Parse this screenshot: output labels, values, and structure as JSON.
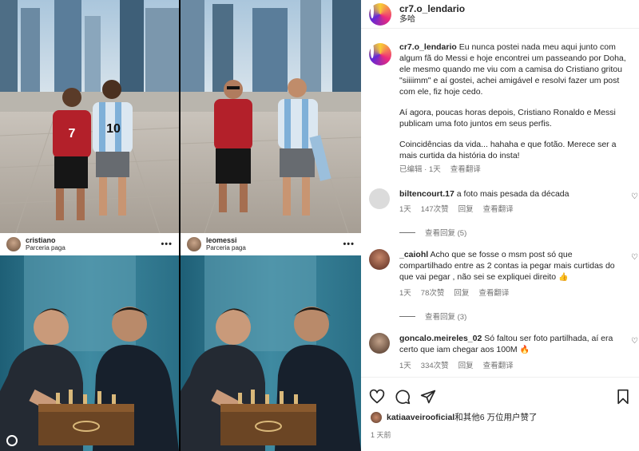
{
  "colors": {
    "accent": "#0095f6",
    "text": "#262626",
    "muted": "#737373",
    "divider": "#efefef"
  },
  "image_cards": {
    "left": {
      "username": "cristiano",
      "label": "Parceria paga"
    },
    "right": {
      "username": "leomessi",
      "label": "Parceria paga"
    },
    "more_icon": "more-dots-icon"
  },
  "post": {
    "username": "cr7.o_lendario",
    "location": "多哈"
  },
  "caption": {
    "username": "cr7.o_lendario",
    "p1": "Eu nunca postei nada meu aqui junto com algum fã do Messi e hoje encontrei um passeando por Doha, ele mesmo quando me viu com a camisa do Cristiano gritou \"siiiimm\" e aí gostei, achei amigável e resolvi fazer um post com ele, fiz hoje cedo.",
    "p2": "Aí agora, poucas horas depois, Cristiano Ronaldo e Messi publicam uma foto juntos em seus perfis.",
    "p3": "Coincidências da vida... hahaha e que fotão. Merece ser a mais curtida da história do insta!",
    "edited": "已编辑 · 1天",
    "see_translation": "查看翻译"
  },
  "comments": [
    {
      "username": "biltencourt.17",
      "text": "a foto mais pesada da década",
      "time": "1天",
      "likes": "147次赞",
      "reply": "回复",
      "translate": "查看翻译",
      "replies": "查看回复 (5)"
    },
    {
      "username": "_caiohl",
      "text": "Acho que se fosse o msm post só que compartilhado entre as 2 contas ia pegar mais curtidas do que vai pegar , não sei se expliquei direito",
      "emoji": "👍",
      "time": "1天",
      "likes": "78次赞",
      "reply": "回复",
      "translate": "查看翻译",
      "replies": "查看回复 (3)"
    },
    {
      "username": "goncalo.meireles_02",
      "text": "Só faltou ser foto partilhada, aí era certo que iam chegar aos 100M",
      "emoji": "🔥",
      "time": "1天",
      "likes": "334次赞",
      "reply": "回复",
      "translate": "查看翻译"
    }
  ],
  "actions": {
    "like_icon": "heart-icon",
    "comment_icon": "comment-icon",
    "share_icon": "share-icon",
    "save_icon": "bookmark-icon"
  },
  "likes": {
    "username": "katiaaveirooficial",
    "rest": "和其他6 万位用户赞了"
  },
  "timestamp": "1 天前"
}
